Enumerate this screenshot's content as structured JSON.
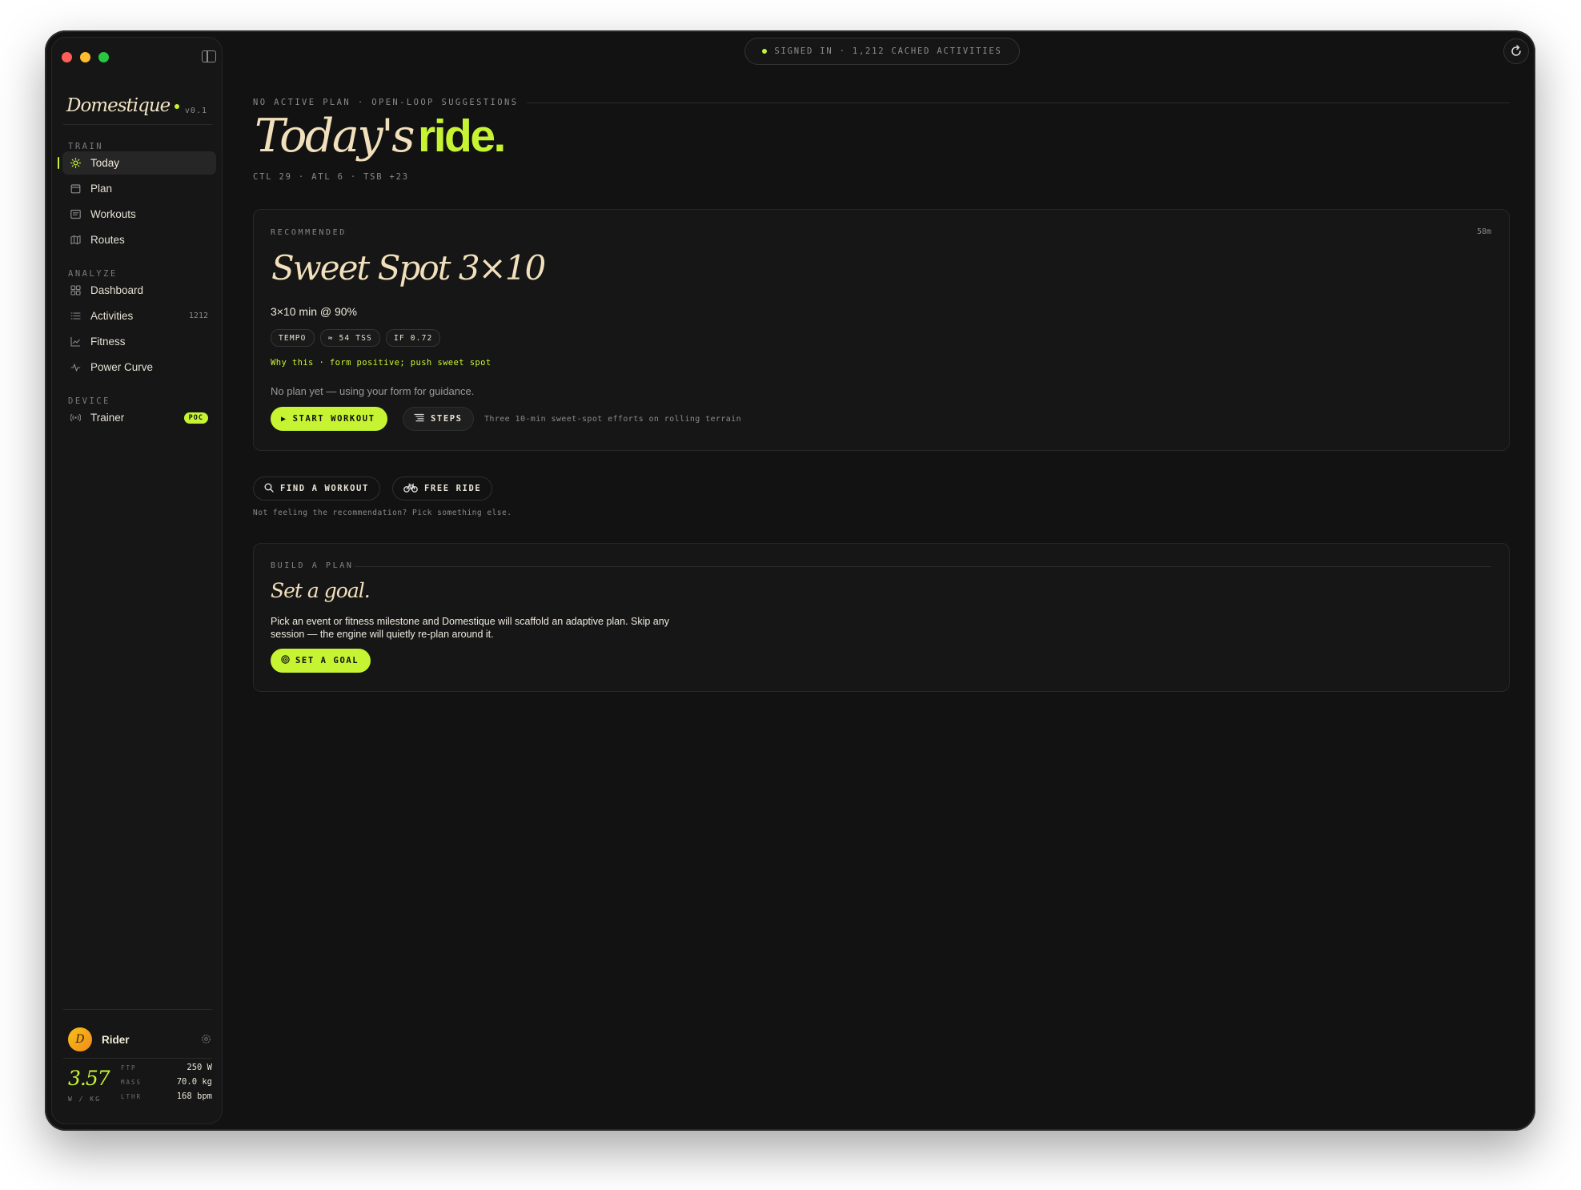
{
  "app": {
    "brand": "Domestique",
    "version": "v0.1"
  },
  "sidebar": {
    "sections": [
      {
        "label": "TRAIN",
        "items": [
          {
            "label": "Today",
            "icon": "sun-icon",
            "active": true
          },
          {
            "label": "Plan",
            "icon": "calendar-icon"
          },
          {
            "label": "Workouts",
            "icon": "list-card-icon"
          },
          {
            "label": "Routes",
            "icon": "map-icon"
          }
        ]
      },
      {
        "label": "ANALYZE",
        "items": [
          {
            "label": "Dashboard",
            "icon": "grid-icon"
          },
          {
            "label": "Activities",
            "icon": "list-icon",
            "count": "1212"
          },
          {
            "label": "Fitness",
            "icon": "trend-icon"
          },
          {
            "label": "Power Curve",
            "icon": "pulse-icon"
          }
        ]
      },
      {
        "label": "DEVICE",
        "items": [
          {
            "label": "Trainer",
            "icon": "broadcast-icon",
            "badge": "POC"
          }
        ]
      }
    ],
    "user": {
      "initial": "D",
      "name": "Rider"
    },
    "wkg": {
      "value": "3.57",
      "unit": "W / KG"
    },
    "stats": [
      {
        "key": "FTP",
        "value": "250 W"
      },
      {
        "key": "MASS",
        "value": "70.0 kg"
      },
      {
        "key": "LTHR",
        "value": "168 bpm"
      }
    ]
  },
  "topbar": {
    "status": "SIGNED IN · 1,212 CACHED ACTIVITIES"
  },
  "main": {
    "eyebrow": "NO ACTIVE PLAN · OPEN-LOOP SUGGESTIONS",
    "headline_a": "Today's",
    "headline_b": "ride.",
    "metrics": "CTL 29 · ATL 6 · TSB +23",
    "recommended": {
      "label": "RECOMMENDED",
      "duration": "58m",
      "title": "Sweet Spot 3×10",
      "desc": "3×10 min @ 90%",
      "tags": [
        "TEMPO",
        "≈ 54 TSS",
        "IF 0.72"
      ],
      "why": "Why this · form positive; push sweet spot",
      "note": "No plan yet — using your form for guidance.",
      "start_label": "START WORKOUT",
      "steps_label": "STEPS",
      "steps_note": "Three 10-min sweet-spot efforts on rolling terrain"
    },
    "alternatives": {
      "find_label": "FIND A WORKOUT",
      "free_label": "FREE RIDE",
      "note": "Not feeling the recommendation? Pick something else."
    },
    "plan": {
      "label": "BUILD A PLAN",
      "title": "Set a goal.",
      "desc": "Pick an event or fitness milestone and Domestique will scaffold an adaptive plan. Skip any session — the engine will quietly re-plan around it.",
      "button": "SET A GOAL"
    }
  },
  "colors": {
    "accent": "#c6f432",
    "bg": "#121212",
    "cream": "#f1e0bb"
  }
}
